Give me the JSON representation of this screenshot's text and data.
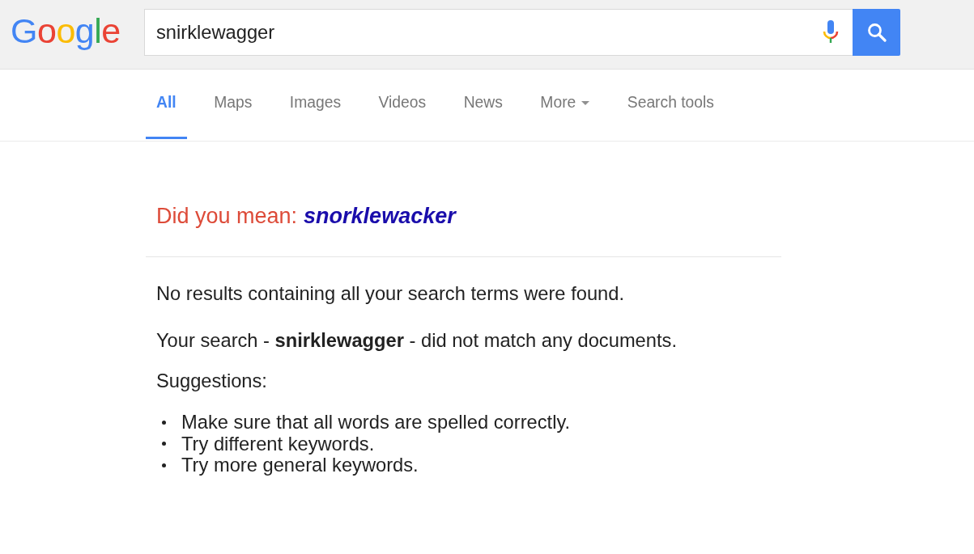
{
  "header": {
    "logo": "Google",
    "search": {
      "value": "snirklewagger"
    }
  },
  "tabs": [
    {
      "label": "All",
      "selected": true,
      "kind": "tab"
    },
    {
      "label": "Maps",
      "selected": false,
      "kind": "tab"
    },
    {
      "label": "Images",
      "selected": false,
      "kind": "tab"
    },
    {
      "label": "Videos",
      "selected": false,
      "kind": "tab"
    },
    {
      "label": "News",
      "selected": false,
      "kind": "tab"
    },
    {
      "label": "More",
      "selected": false,
      "kind": "dropdown"
    },
    {
      "label": "Search tools",
      "selected": false,
      "kind": "tab"
    }
  ],
  "spelling": {
    "prompt": "Did you mean:",
    "suggestion": "snorklewacker"
  },
  "results": {
    "message": "No results containing all your search terms were found.",
    "detail": "Your search - **snirklewagger** - did not match any documents.",
    "suggestions_heading": "Suggestions:",
    "suggestions": [
      "Make sure that all words are spelled correctly.",
      "Try different keywords.",
      "Try more general keywords."
    ]
  }
}
